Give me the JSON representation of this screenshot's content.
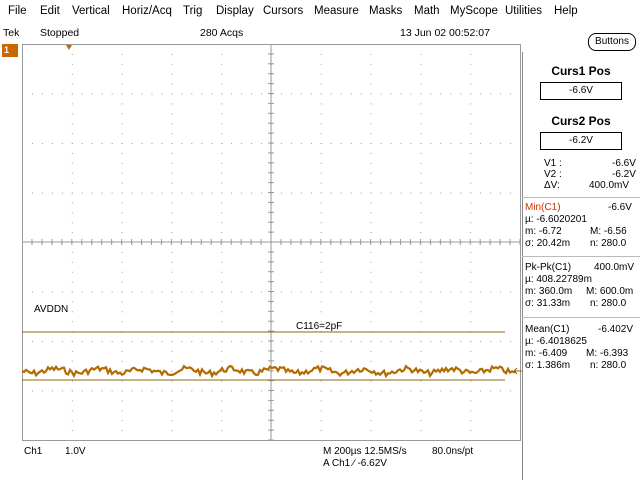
{
  "menu": [
    "File",
    "Edit",
    "Vertical",
    "Horiz/Acq",
    "Trig",
    "Display",
    "Cursors",
    "Measure",
    "Masks",
    "Math",
    "MyScope",
    "Utilities",
    "Help"
  ],
  "status": {
    "brand": "Tek",
    "state": "Stopped",
    "acqs": "280 Acqs",
    "datetime": "13 Jun 02 00:52:07",
    "buttons_label": "Buttons"
  },
  "channel_marker": "1",
  "screen": {
    "signal_label": "AVDDN",
    "cap_label": "C116=2pF"
  },
  "bottom": {
    "ch": "Ch1",
    "scale": "1.0V",
    "timebase": "M 200µs 12.5MS/s",
    "pt": "80.0ns/pt",
    "trigger": "A  Ch1  ∕  -6.62V"
  },
  "cursors": {
    "title1": "Curs1 Pos",
    "value1": "-6.6V",
    "title2": "Curs2 Pos",
    "value2": "-6.2V",
    "readout": [
      {
        "k": "V1 :",
        "v": "-6.6V"
      },
      {
        "k": "V2 :",
        "v": "-6.2V"
      },
      {
        "k": "ΔV:",
        "v": "400.0mV"
      }
    ]
  },
  "measurements": [
    {
      "title": "Min(C1)",
      "value": "-6.6V",
      "mu": "µ: -6.6020201",
      "m": "m: -6.72",
      "M": "M: -6.56",
      "sigma": "σ: 20.42m",
      "n": "n: 280.0"
    },
    {
      "title": "Pk-Pk(C1)",
      "value": "400.0mV",
      "mu": "µ: 408.22789m",
      "m": "m: 360.0m",
      "M": "M: 600.0m",
      "sigma": "σ: 31.33m",
      "n": "n: 280.0"
    },
    {
      "title": "Mean(C1)",
      "value": "-6.402V",
      "mu": "µ: -6.4018625",
      "m": "m: -6.409",
      "M": "M: -6.393",
      "sigma": "σ: 1.386m",
      "n": "n: 280.0"
    }
  ],
  "colors": {
    "trace": "#b36b00",
    "cursor": "#8a6a10",
    "grid": "#9a9a9a",
    "marker": "#cc6600"
  }
}
